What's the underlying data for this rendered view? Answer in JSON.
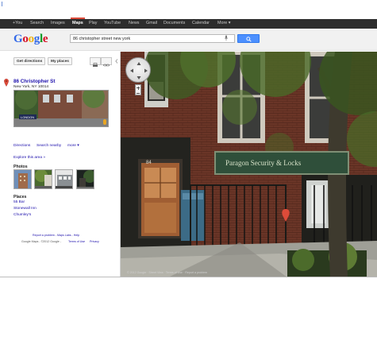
{
  "gbar": {
    "items": [
      "+You",
      "Search",
      "Images",
      "Maps",
      "Play",
      "YouTube",
      "News",
      "Gmail",
      "Documents",
      "Calendar",
      "More ▾"
    ],
    "active_label": "Maps"
  },
  "header": {
    "logo_letters": [
      "G",
      "o",
      "o",
      "g",
      "l",
      "e"
    ],
    "logo_colors": [
      "#3369e8",
      "#d50f25",
      "#eeb211",
      "#3369e8",
      "#009925",
      "#d50f25"
    ],
    "search_value": "86 christopher street new york"
  },
  "sidebar": {
    "get_directions_label": "Get directions",
    "my_places_label": "My places",
    "place": {
      "title": "86 Christopher St",
      "address": "New York, NY 10014",
      "thumb_sign": "LONDON"
    },
    "actions": {
      "directions": "Directions",
      "search_nearby": "Search nearby",
      "more": "more ▾"
    },
    "explore_label": "Explore this area »",
    "photos_heading": "Photos",
    "places_heading": "Places",
    "places": [
      "55 Bar",
      "Stonewall Inn",
      "Chumley's"
    ],
    "footer_links": "Report a problem - Maps Labs - Help",
    "footer_legal_prefix": "Google Maps - ©2012 Google -",
    "footer_terms": "Terms of Use",
    "footer_privacy": "Privacy"
  },
  "map": {
    "door_number": "84",
    "sign_text": "Paragon Security & Locks",
    "copyright": "© 2012 Google · Street View · Terms of Use · Report a problem"
  },
  "colors": {
    "accent": "#4d90fe",
    "link": "#1a0dab",
    "gbar": "#2d2d2d",
    "marker": "#dd4b39"
  }
}
